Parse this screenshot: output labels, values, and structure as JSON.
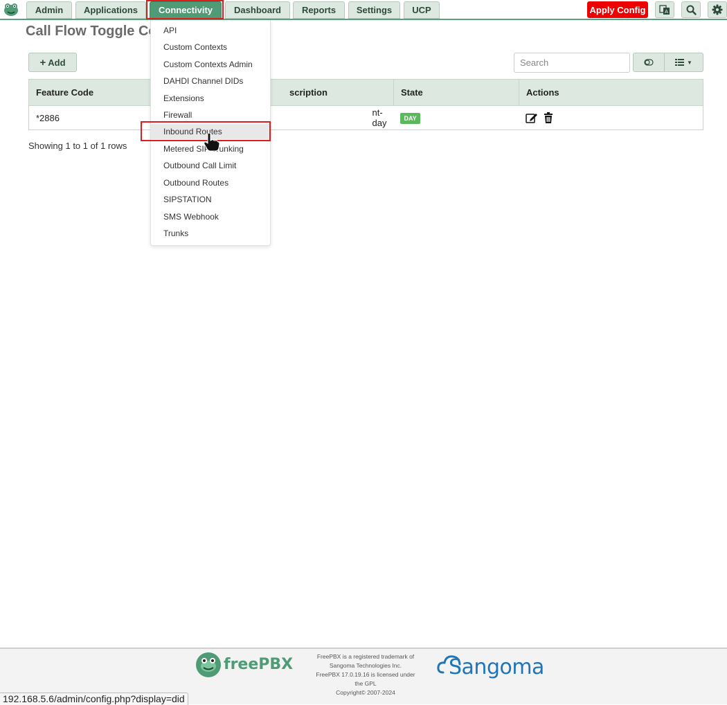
{
  "nav": {
    "tabs": [
      "Admin",
      "Applications",
      "Connectivity",
      "Dashboard",
      "Reports",
      "Settings",
      "UCP"
    ],
    "active": "Connectivity",
    "apply_config": "Apply Config"
  },
  "page": {
    "title": "Call Flow Toggle Co",
    "add_label": "Add",
    "search_placeholder": "Search",
    "showing": "Showing 1 to 1 of 1 rows"
  },
  "table": {
    "headers": [
      "Feature Code",
      "scription",
      "State",
      "Actions"
    ],
    "rows": [
      {
        "feature_code": "*2886",
        "description": "nt-day",
        "state": "DAY"
      }
    ]
  },
  "dropdown": {
    "items": [
      "API",
      "Custom Contexts",
      "Custom Contexts Admin",
      "DAHDI Channel DIDs",
      "Extensions",
      "Firewall",
      "Inbound Routes",
      "Metered SIP Trunking",
      "Outbound Call Limit",
      "Outbound Routes",
      "SIPSTATION",
      "SMS Webhook",
      "Trunks"
    ],
    "hovered": "Inbound Routes"
  },
  "footer": {
    "freepbx_logo": "freePBX",
    "lines": [
      "FreePBX is a registered trademark of",
      "Sangoma Technologies Inc.",
      "FreePBX 17.0.19.16 is licensed under",
      "the GPL",
      "Copyright© 2007-2024"
    ],
    "sangoma_logo": "Sangoma"
  },
  "status_url": "192.168.5.6/admin/config.php?display=did",
  "colors": {
    "accent": "#4e9b75",
    "apply": "#ee0000",
    "highlight": "#e01b1b",
    "badge": "#5cb85c"
  }
}
